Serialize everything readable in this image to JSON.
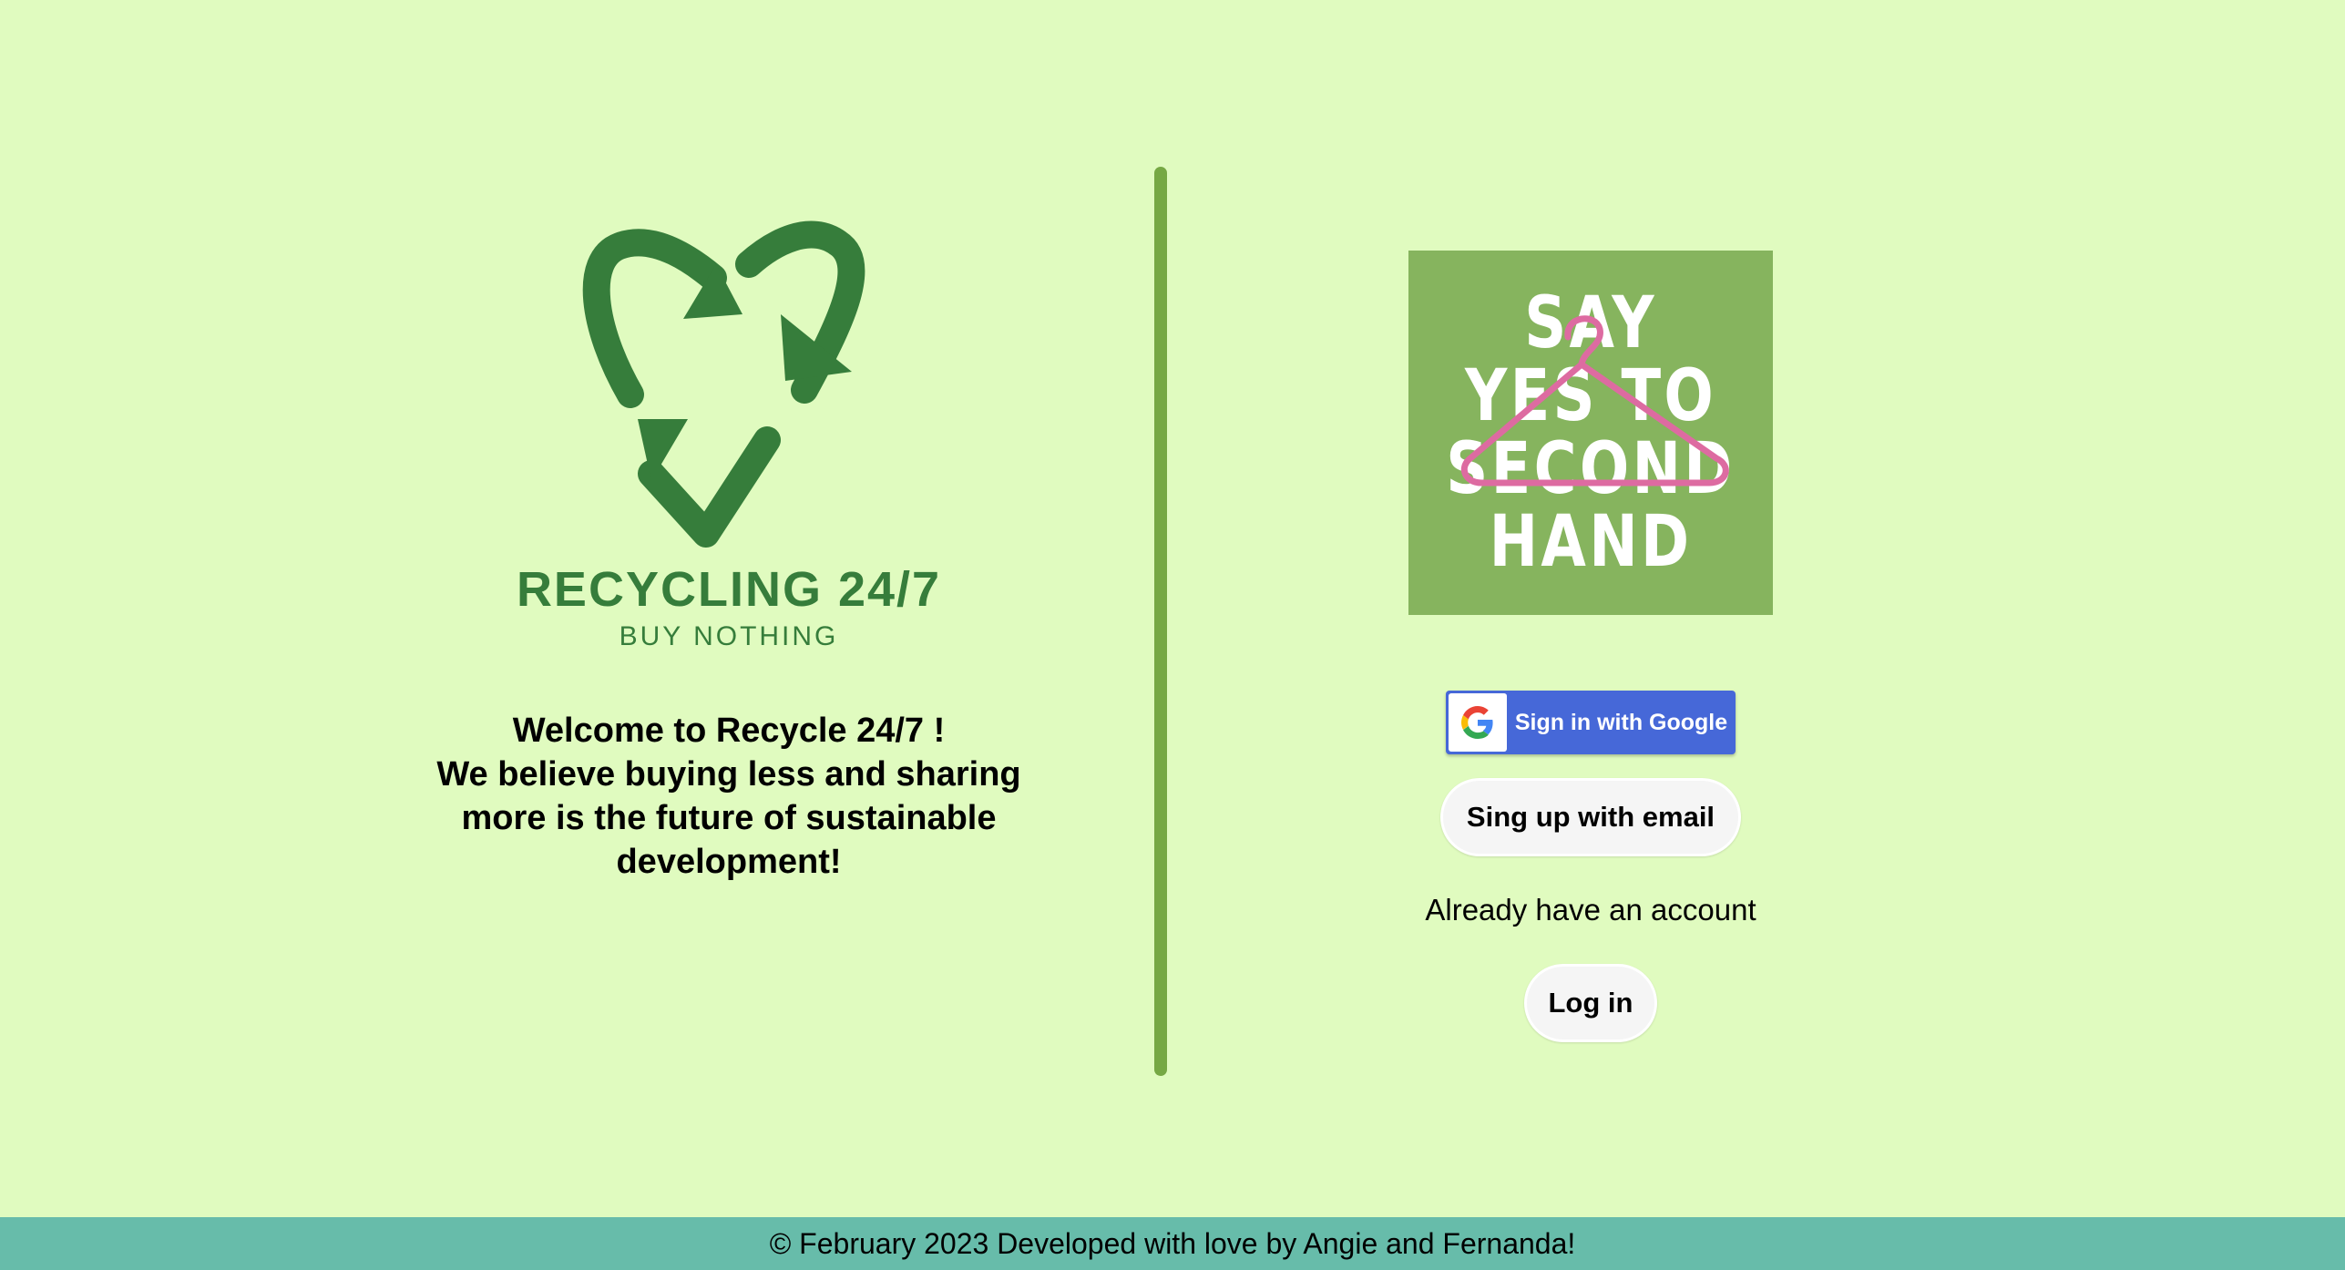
{
  "brand": {
    "logo_icon": "recycle-arrows-icon",
    "title": "RECYCLING 24/7",
    "subtitle": "BUY NOTHING"
  },
  "welcome": {
    "line1": "Welcome to Recycle 24/7 !",
    "line2": "We believe buying less and sharing more is the future of sustainable development!"
  },
  "poster": {
    "line1": "SAY",
    "line2": "YES TO",
    "line3": "SECOND",
    "line4": "HAND",
    "decoration_icon": "clothes-hanger-icon"
  },
  "auth": {
    "google_label": "Sign in with Google",
    "email_label": "Sing up with email",
    "already_text": "Already have an account",
    "login_label": "Log in"
  },
  "footer": {
    "text": "© February 2023 Developed with love by Angie and Fernanda!"
  },
  "colors": {
    "background": "#e0fbbf",
    "brand_green": "#367d3b",
    "divider": "#76a844",
    "poster_bg": "#86b45e",
    "hanger": "#dd6ba1",
    "google_blue": "#4668d8",
    "footer_bg": "#67bcaa"
  }
}
